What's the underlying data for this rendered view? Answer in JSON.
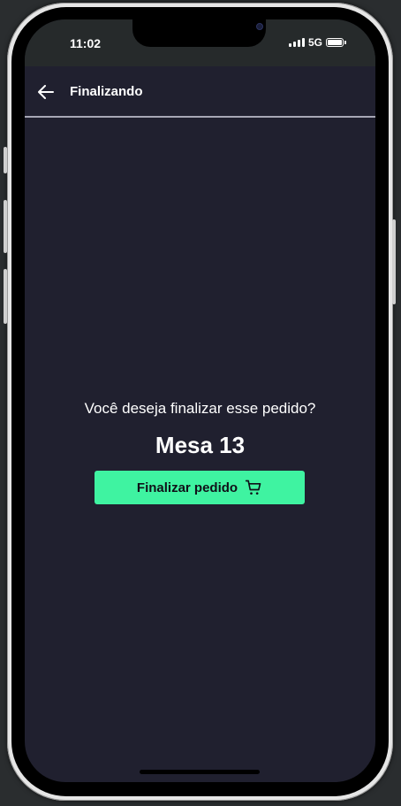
{
  "status_bar": {
    "time": "11:02",
    "network": "5G",
    "signal_icon": "signal-bars-icon",
    "battery_icon": "battery-icon",
    "battery_level": 1.0
  },
  "header": {
    "back_icon": "arrow-left-icon",
    "title": "Finalizando"
  },
  "main": {
    "question": "Você deseja finalizar esse pedido?",
    "table_name": "Mesa 13",
    "finish_button": {
      "label": "Finalizar pedido",
      "icon": "cart-icon"
    }
  },
  "colors": {
    "screen_background": "#20202f",
    "status_bar_background": "#262a2b",
    "header_divider": "#a7a7b5",
    "accent": "#3ff3a1",
    "text_primary": "#ffffff",
    "button_text": "#101018"
  }
}
